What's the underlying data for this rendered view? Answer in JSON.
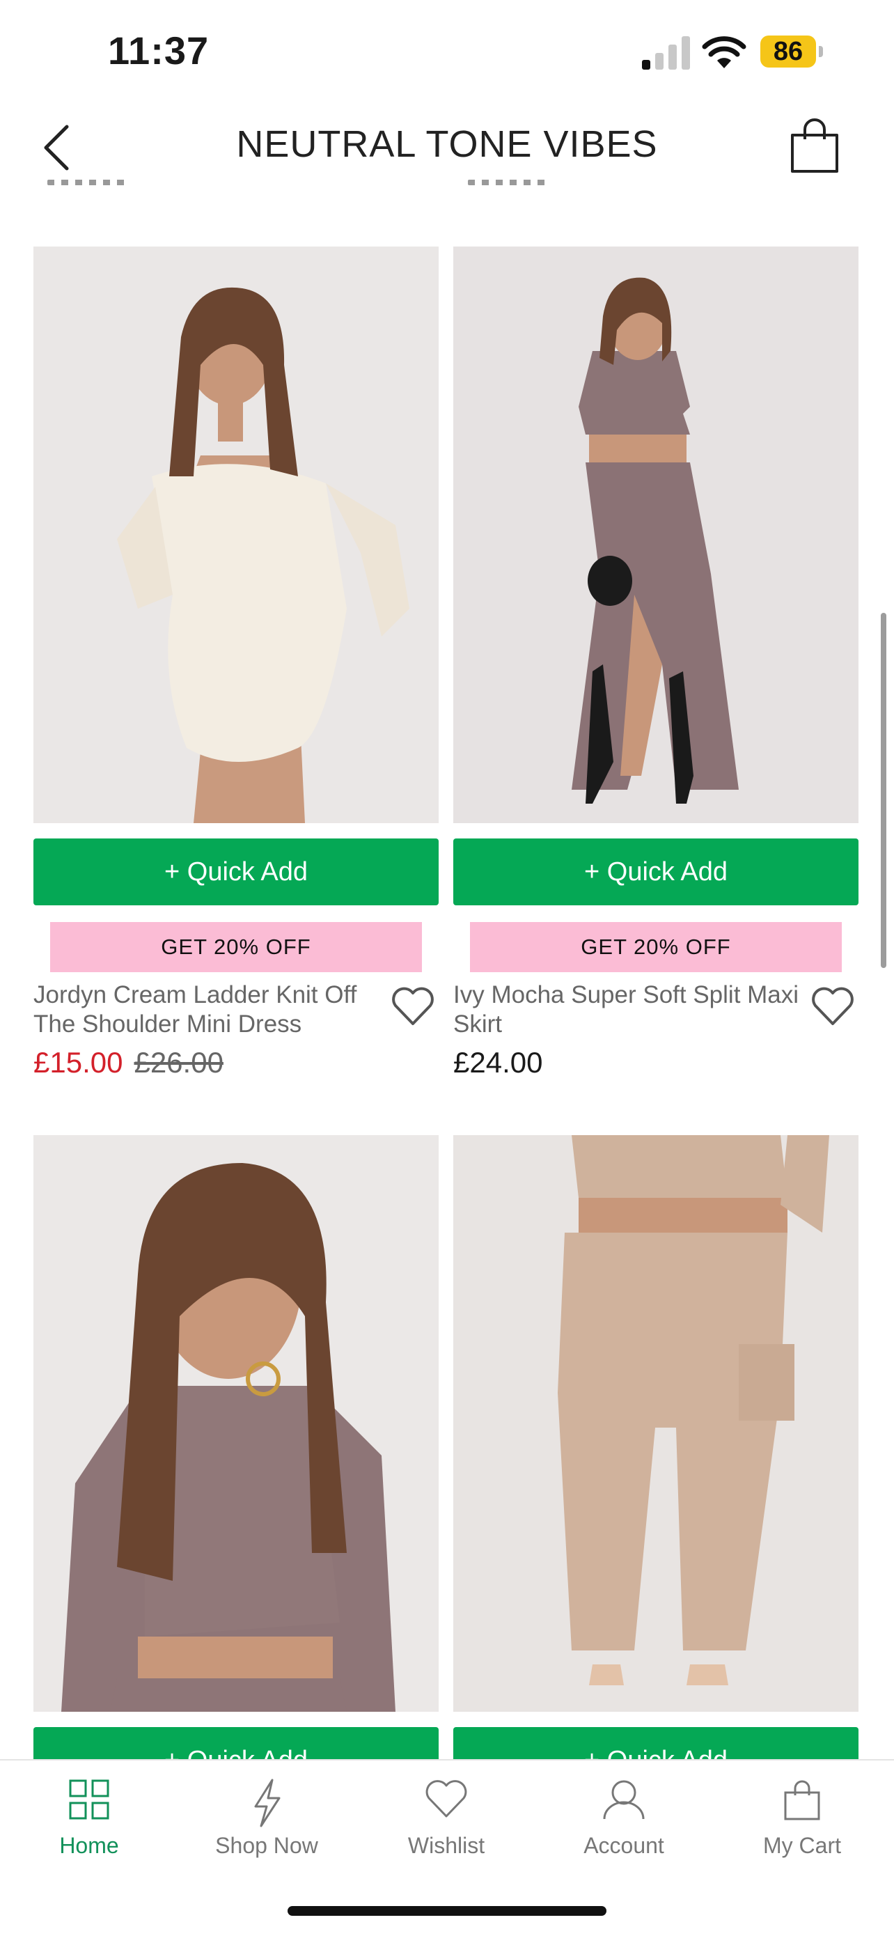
{
  "status_bar": {
    "time": "11:37",
    "battery": "86"
  },
  "header": {
    "title": "NEUTRAL TONE VIBES",
    "back_icon": "chevron-left-icon",
    "cart_icon": "shopping-bag-icon"
  },
  "products": [
    {
      "quick_add": "+ Quick Add",
      "promo": "GET 20% OFF",
      "name": "Jordyn Cream Ladder Knit Off The Shoulder Mini Dress",
      "price": "£15.00",
      "old_price": "£26.00"
    },
    {
      "quick_add": "+ Quick Add",
      "promo": "GET 20% OFF",
      "name": "Ivy Mocha Super Soft Split Maxi Skirt",
      "price": "£24.00"
    },
    {
      "quick_add": "+ Quick Add"
    },
    {
      "quick_add": "+ Quick Add"
    }
  ],
  "tab_bar": {
    "items": [
      {
        "label": "Home",
        "icon": "grid-icon",
        "active": true
      },
      {
        "label": "Shop Now",
        "icon": "lightning-icon"
      },
      {
        "label": "Wishlist",
        "icon": "heart-icon"
      },
      {
        "label": "Account",
        "icon": "person-icon"
      },
      {
        "label": "My Cart",
        "icon": "bag-icon"
      }
    ]
  },
  "colors": {
    "accent_green": "#05a855",
    "promo_pink": "#fbbcd5",
    "sale_red": "#d3202a",
    "tab_active": "#12915a"
  }
}
